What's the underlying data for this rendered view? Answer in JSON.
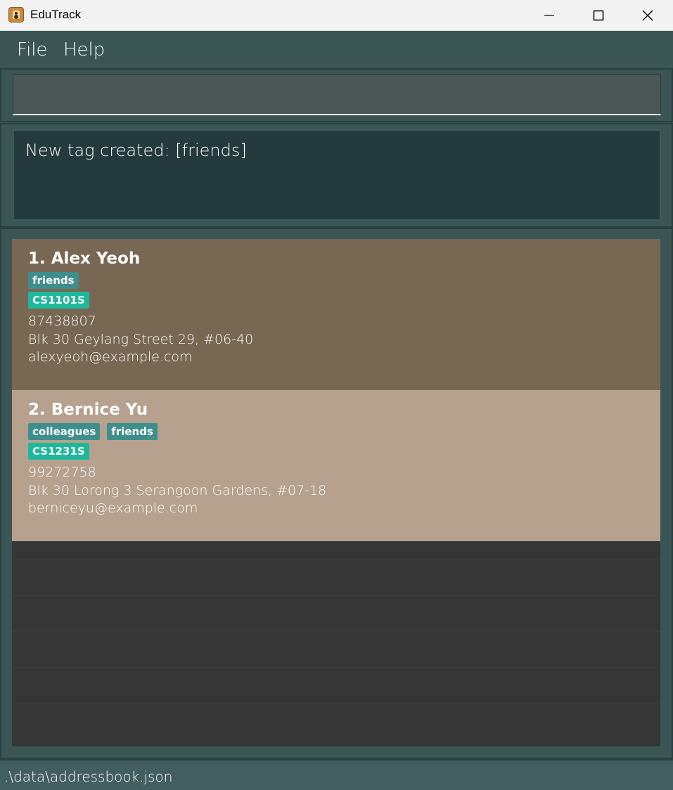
{
  "window": {
    "title": "EduTrack",
    "icon": "address-book-icon",
    "controls": [
      "minimize-icon",
      "maximize-icon",
      "close-icon"
    ]
  },
  "menu": {
    "file": "File",
    "help": "Help"
  },
  "command": {
    "value": "",
    "placeholder": ""
  },
  "result": {
    "message": "New tag created: [friends]"
  },
  "persons": [
    {
      "index_name": "1.  Alex Yeoh",
      "social_tags": [
        "friends"
      ],
      "course_tags": [
        "CS1101S"
      ],
      "phone": "87438807",
      "address": "Blk 30 Geylang Street 29, #06-40",
      "email": "alexyeoh@example.com",
      "selected": true
    },
    {
      "index_name": "2.  Bernice Yu",
      "social_tags": [
        "colleagues",
        "friends"
      ],
      "course_tags": [
        "CS1231S"
      ],
      "phone": "99272758",
      "address": "Blk 30 Lorong 3 Serangoon Gardens, #07-18",
      "email": "berniceyu@example.com",
      "selected": false
    }
  ],
  "status": {
    "path": ".\\data\\addressbook.json"
  },
  "colors": {
    "background": "#3b5555",
    "selected_card": "#786753",
    "unselected_card": "#b5a18e",
    "social_tag": "#3e8e8c",
    "course_tag": "#1db89a",
    "list_empty": "#363636"
  }
}
